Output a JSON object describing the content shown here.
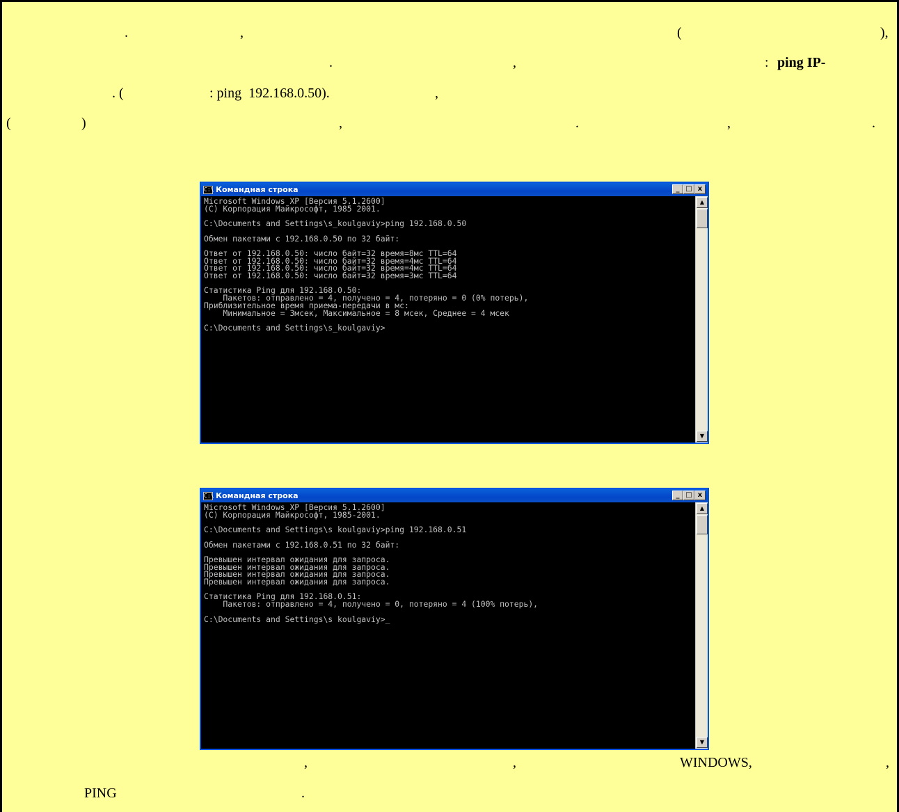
{
  "text": {
    "l1_dot": ".",
    "l1_comma": ",",
    "l1_paren_open": "(",
    "l1_paren_close": "),",
    "l2_dot": ".",
    "l2_comma": ",",
    "l2_colon": ":",
    "l2_ping": "ping IP-",
    "l3_open": ". (",
    "l3_example": ": ping  192.168.0.50).",
    "l3_comma": ",",
    "l4_open": "(",
    "l4_close": ")",
    "l4_comma1": ",",
    "l4_dot1": ".",
    "l4_comma2": ",",
    "l4_dot2": ".",
    "b1_comma1": ",",
    "b1_comma2": ",",
    "b1_windows": "WINDOWS,",
    "b1_comma3": ",",
    "b2_ping": "PING",
    "b2_dot": "."
  },
  "console1": {
    "title": "Командная строка",
    "icon": "cmd-icon",
    "lines": [
      "Microsoft Windows XP [Версия 5.1.2600]",
      "(С) Корпорация Майкрософт, 1985 2001.",
      "",
      "C:\\Documents and Settings\\s_koulgaviy>ping 192.168.0.50",
      "",
      "Обмен пакетами с 192.168.0.50 по 32 байт:",
      "",
      "Ответ от 192.168.0.50: число байт=32 время=8мс TTL=64",
      "Ответ от 192.168.0.50: число байт=32 время=4мс TTL=64",
      "Ответ от 192.168.0.50: число байт=32 время=4мс TTL=64",
      "Ответ от 192.168.0.50: число байт=32 время=3мс TTL=64",
      "",
      "Статистика Ping для 192.168.0.50:",
      "    Пакетов: отправлено = 4, получено = 4, потеряно = 0 (0% потерь),",
      "Приблизительное время приема-передачи в мс:",
      "    Минимальное = 3мсек, Максимальное = 8 мсек, Среднее = 4 мсек",
      "",
      "C:\\Documents and Settings\\s_koulgaviy>"
    ]
  },
  "console2": {
    "title": "Командная строка",
    "icon": "cmd-icon",
    "lines": [
      "Microsoft Windows XP [Версия 5.1.2600]",
      "(С) Корпорация Майкрософт, 1985-2001.",
      "",
      "C:\\Documents and Settings\\s koulgaviy>ping 192.168.0.51",
      "",
      "Обмен пакетами с 192.168.0.51 по 32 байт:",
      "",
      "Превышен интервал ожидания для запроса.",
      "Превышен интервал ожидания для запроса.",
      "Превышен интервал ожидания для запроса.",
      "Превышен интервал ожидания для запроса.",
      "",
      "Статистика Ping для 192.168.0.51:",
      "    Пакетов: отправлено = 4, получено = 0, потеряно = 4 (100% потерь),",
      "",
      "C:\\Documents and Settings\\s koulgaviy>_"
    ]
  },
  "window_buttons": {
    "minimize": "_",
    "maximize": "□",
    "close": "x"
  },
  "scroll_buttons": {
    "up": "▲",
    "down": "▼"
  }
}
